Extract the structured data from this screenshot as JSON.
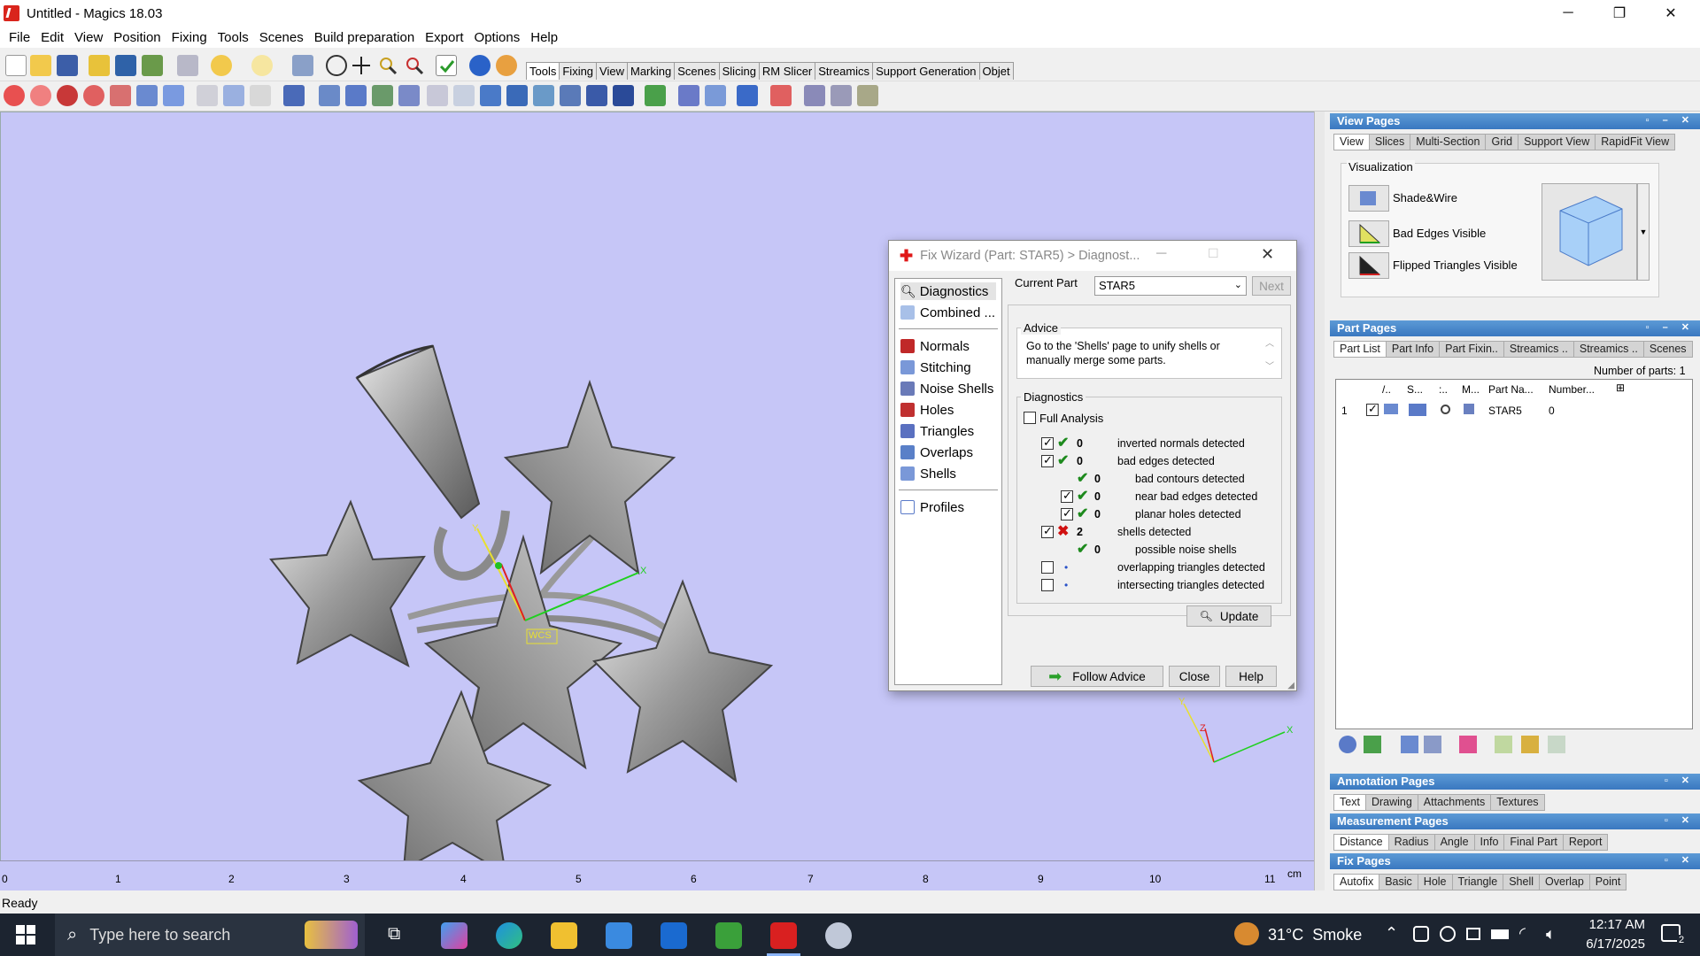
{
  "window": {
    "title": "Untitled - Magics 18.03",
    "minimize": "─",
    "restore": "❐",
    "close": "✕"
  },
  "menu": [
    "File",
    "Edit",
    "View",
    "Position",
    "Fixing",
    "Tools",
    "Scenes",
    "Build preparation",
    "Export",
    "Options",
    "Help"
  ],
  "toolbar_tabs": [
    "Tools",
    "Fixing",
    "View",
    "Marking",
    "Scenes",
    "Slicing",
    "RM Slicer",
    "Streamics",
    "Support Generation",
    "Objet"
  ],
  "viewport": {
    "wcs_label": "WCS",
    "axis_x": "X",
    "axis_y": "Y",
    "axis_z": "Z",
    "ruler_ticks": [
      "0",
      "1",
      "2",
      "3",
      "4",
      "5",
      "6",
      "7",
      "8",
      "9",
      "10",
      "11"
    ],
    "ruler_unit": "cm"
  },
  "status": "Ready",
  "view_pages": {
    "title": "View Pages",
    "tabs": [
      "View",
      "Slices",
      "Multi-Section",
      "Grid",
      "Support View",
      "RapidFit View"
    ],
    "group": "Visualization",
    "options": [
      "Shade&Wire",
      "Bad Edges Visible",
      "Flipped Triangles Visible"
    ]
  },
  "part_pages": {
    "title": "Part Pages",
    "tabs": [
      "Part List",
      "Part Info",
      "Part Fixin..",
      "Streamics ..",
      "Streamics ..",
      "Scenes"
    ],
    "count_label": "Number of parts: 1",
    "columns": [
      "/..",
      "S...",
      ":..",
      "M...",
      "Part Na...",
      "Number..."
    ],
    "row": {
      "index": "1",
      "name": "STAR5",
      "number": "0"
    }
  },
  "annotation_pages": {
    "title": "Annotation Pages",
    "tabs": [
      "Text",
      "Drawing",
      "Attachments",
      "Textures"
    ]
  },
  "measurement_pages": {
    "title": "Measurement Pages",
    "tabs": [
      "Distance",
      "Radius",
      "Angle",
      "Info",
      "Final Part",
      "Report"
    ]
  },
  "fix_pages": {
    "title": "Fix Pages",
    "tabs": [
      "Autofix",
      "Basic",
      "Hole",
      "Triangle",
      "Shell",
      "Overlap",
      "Point"
    ]
  },
  "dialog": {
    "title": "Fix Wizard (Part: STAR5) > Diagnost...",
    "nav_top": [
      "Diagnostics",
      "Combined ..."
    ],
    "nav_main": [
      "Normals",
      "Stitching",
      "Noise Shells",
      "Holes",
      "Triangles",
      "Overlaps",
      "Shells"
    ],
    "nav_bottom": "Profiles",
    "current_part_label": "Current Part",
    "current_part_value": "STAR5",
    "next_label": "Next",
    "advice_title": "Advice",
    "advice_text": "Go to the 'Shells' page to unify shells or manually merge some parts.",
    "diagnostics_title": "Diagnostics",
    "full_analysis": "Full Analysis",
    "items": [
      {
        "checked": true,
        "status": "ok",
        "count": "0",
        "label": "inverted normals detected",
        "indent": 0
      },
      {
        "checked": true,
        "status": "ok",
        "count": "0",
        "label": "bad edges detected",
        "indent": 0
      },
      {
        "checked": false,
        "status": "ok",
        "count": "0",
        "label": "bad contours detected",
        "indent": 1,
        "nocheck": true
      },
      {
        "checked": true,
        "status": "ok",
        "count": "0",
        "label": "near bad edges detected",
        "indent": 1
      },
      {
        "checked": true,
        "status": "ok",
        "count": "0",
        "label": "planar holes detected",
        "indent": 1
      },
      {
        "checked": true,
        "status": "bad",
        "count": "2",
        "label": "shells detected",
        "indent": 0
      },
      {
        "checked": false,
        "status": "ok",
        "count": "0",
        "label": "possible noise shells",
        "indent": 1,
        "nocheck": true
      },
      {
        "checked": false,
        "status": "dot",
        "count": "",
        "label": "overlapping triangles detected",
        "indent": 0
      },
      {
        "checked": false,
        "status": "dot",
        "count": "",
        "label": "intersecting triangles detected",
        "indent": 0
      }
    ],
    "update_label": "Update",
    "follow_label": "Follow Advice",
    "close_label": "Close",
    "help_label": "Help"
  },
  "taskbar": {
    "search_placeholder": "Type here to search",
    "weather": "31°C  Smoke",
    "time": "12:17 AM",
    "date": "6/17/2025",
    "notifications": "2"
  }
}
